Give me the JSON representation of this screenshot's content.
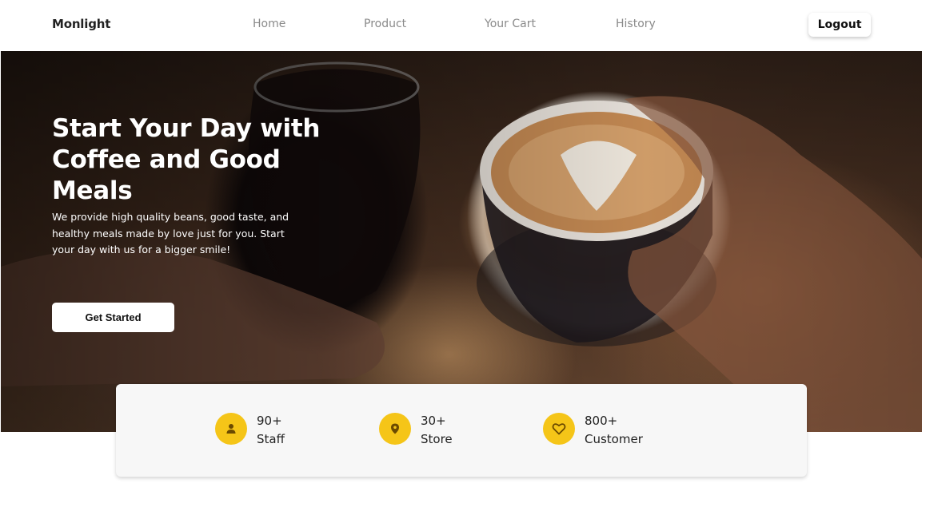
{
  "nav": {
    "brand": "Monlight",
    "links": [
      "Home",
      "Product",
      "Your Cart",
      "History"
    ],
    "logout_label": "Logout"
  },
  "hero": {
    "title": "Start Your Day with Coffee and Good Meals",
    "description": "We provide high quality beans, good taste, and healthy meals made by love just for you. Start your day with us for a bigger smile!",
    "cta_label": "Get Started"
  },
  "stats": [
    {
      "value": "90+",
      "label": "Staff",
      "icon": "person-icon"
    },
    {
      "value": "30+",
      "label": "Store",
      "icon": "location-pin-icon"
    },
    {
      "value": "800+",
      "label": "Customer",
      "icon": "heart-icon"
    }
  ],
  "colors": {
    "accent": "#f5c518",
    "icon_fill": "#6b4a00",
    "nav_link": "#8a8a8a",
    "card_bg": "#f7f7f7"
  }
}
